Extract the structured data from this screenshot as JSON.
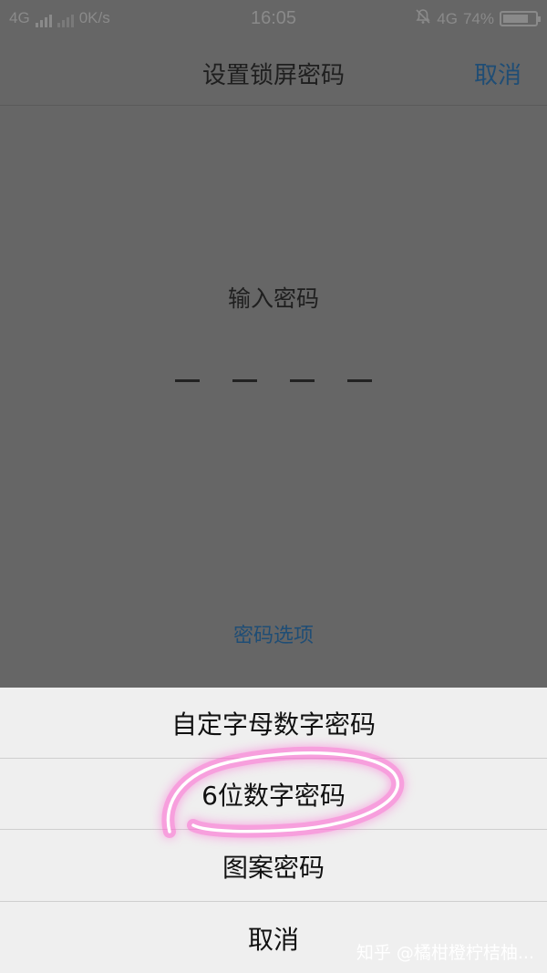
{
  "status_bar": {
    "network_left": "4G",
    "speed": "0K/s",
    "time": "16:05",
    "network_right": "4G",
    "battery": "74%",
    "icons": [
      "signal-icon",
      "signal-icon-dim",
      "bell-muted-icon",
      "battery-icon"
    ]
  },
  "nav": {
    "title": "设置锁屏密码",
    "cancel_label": "取消"
  },
  "main": {
    "prompt": "输入密码",
    "digit_count": 4,
    "options_link": "密码选项"
  },
  "sheet": {
    "items": [
      {
        "label": "自定字母数字密码"
      },
      {
        "label": "6位数字密码"
      },
      {
        "label": "图案密码"
      },
      {
        "label": "取消"
      }
    ]
  },
  "watermark": "知乎 @橘柑橙柠桔柚..."
}
